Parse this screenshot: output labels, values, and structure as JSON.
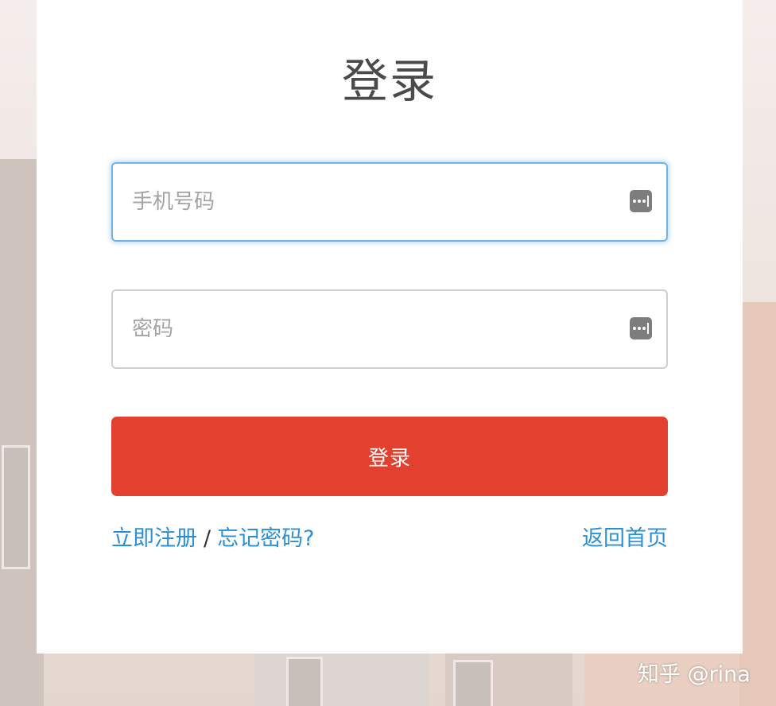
{
  "login": {
    "title": "登录",
    "phone_placeholder": "手机号码",
    "password_placeholder": "密码",
    "submit_label": "登录",
    "register_link": "立即注册",
    "separator": "/",
    "forgot_link": "忘记密码?",
    "home_link": "返回首页"
  },
  "icons": {
    "phone_field_icon": "password-manager-key-icon",
    "password_field_icon": "password-manager-key-icon"
  },
  "colors": {
    "primary_button": "#e3412f",
    "link": "#2b8fd6",
    "focus_border": "#74b3e3"
  },
  "watermark": {
    "text": "知乎 @rina"
  }
}
